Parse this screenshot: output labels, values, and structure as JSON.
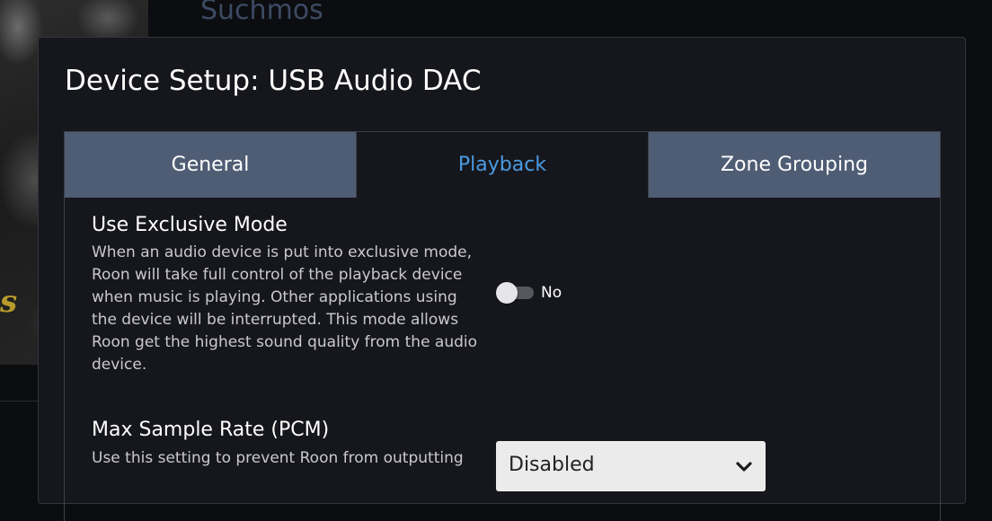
{
  "background": {
    "artist_name": "Suchmos",
    "album_art_text": "s"
  },
  "dialog": {
    "title": "Device Setup: USB Audio DAC",
    "tabs": [
      {
        "label": "General",
        "active": false
      },
      {
        "label": "Playback",
        "active": true
      },
      {
        "label": "Zone Grouping",
        "active": false
      }
    ]
  },
  "settings": {
    "exclusive_mode": {
      "title": "Use Exclusive Mode",
      "description": "When an audio device is put into exclusive mode, Roon will take full control of the playback device when music is playing. Other applications using the device will be interrupted. This mode allows Roon get the highest sound quality from the audio device.",
      "toggle_label": "No",
      "enabled": false
    },
    "max_sample_rate": {
      "title": "Max Sample Rate (PCM)",
      "description": "Use this setting to prevent Roon from outputting",
      "selected": "Disabled"
    }
  },
  "colors": {
    "active_tab_text": "#4a9be2",
    "inactive_tab_bg": "#4f5d74",
    "dialog_bg": "#16171c"
  }
}
